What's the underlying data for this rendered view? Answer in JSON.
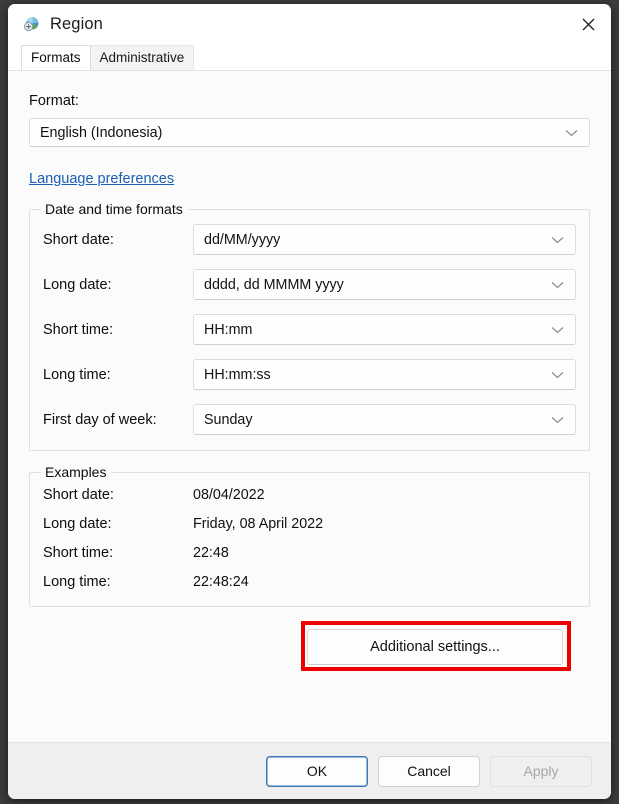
{
  "window": {
    "title": "Region",
    "icon": "region-globe-icon",
    "close_label": "Close"
  },
  "tabs": [
    {
      "label": "Formats",
      "active": true
    },
    {
      "label": "Administrative",
      "active": false
    }
  ],
  "format": {
    "label": "Format:",
    "value": "English (Indonesia)",
    "language_link": "Language preferences"
  },
  "date_time_formats": {
    "title": "Date and time formats",
    "rows": [
      {
        "label": "Short date:",
        "value": "dd/MM/yyyy"
      },
      {
        "label": "Long date:",
        "value": "dddd, dd MMMM yyyy"
      },
      {
        "label": "Short time:",
        "value": "HH:mm"
      },
      {
        "label": "Long time:",
        "value": "HH:mm:ss"
      },
      {
        "label": "First day of week:",
        "value": "Sunday"
      }
    ]
  },
  "examples": {
    "title": "Examples",
    "rows": [
      {
        "label": "Short date:",
        "value": "08/04/2022"
      },
      {
        "label": "Long date:",
        "value": "Friday, 08 April 2022"
      },
      {
        "label": "Short time:",
        "value": "22:48"
      },
      {
        "label": "Long time:",
        "value": "22:48:24"
      }
    ]
  },
  "additional_settings": {
    "label": "Additional settings...",
    "highlight_color": "#ec0000"
  },
  "footer": {
    "ok": "OK",
    "cancel": "Cancel",
    "apply": "Apply",
    "apply_disabled": true
  },
  "colors": {
    "link": "#1a5fb4",
    "default_button_border": "#3878b4",
    "footer_background": "#efefef",
    "page_background": "#fbfbfb"
  }
}
